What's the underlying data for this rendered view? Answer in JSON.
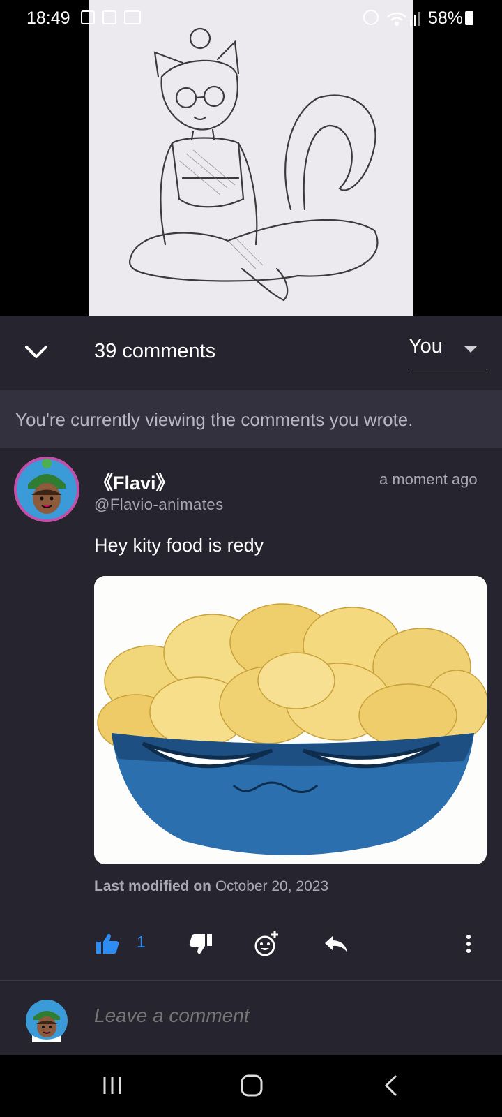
{
  "status_bar": {
    "time": "18:49",
    "battery": "58%",
    "icons": [
      "gallery-icon",
      "video-icon",
      "vpn-icon",
      "alarm-icon",
      "wifi-icon",
      "signal-icon",
      "battery-icon"
    ]
  },
  "header": {
    "comments_count": "39 comments",
    "filter_value": "You"
  },
  "notice": {
    "text": "You're currently viewing the comments you wrote."
  },
  "comment": {
    "author": "《Flavi》",
    "handle": "@Flavio-animates",
    "timestamp": "a moment ago",
    "text": "Hey kity food is redy",
    "modified_label": "Last modified on",
    "modified_date": "October 20, 2023",
    "like_count": "1"
  },
  "composer": {
    "placeholder": "Leave a comment"
  },
  "colors": {
    "panel": "#25242f",
    "notice_bg": "#32313d",
    "accent": "#2f8cf0"
  }
}
